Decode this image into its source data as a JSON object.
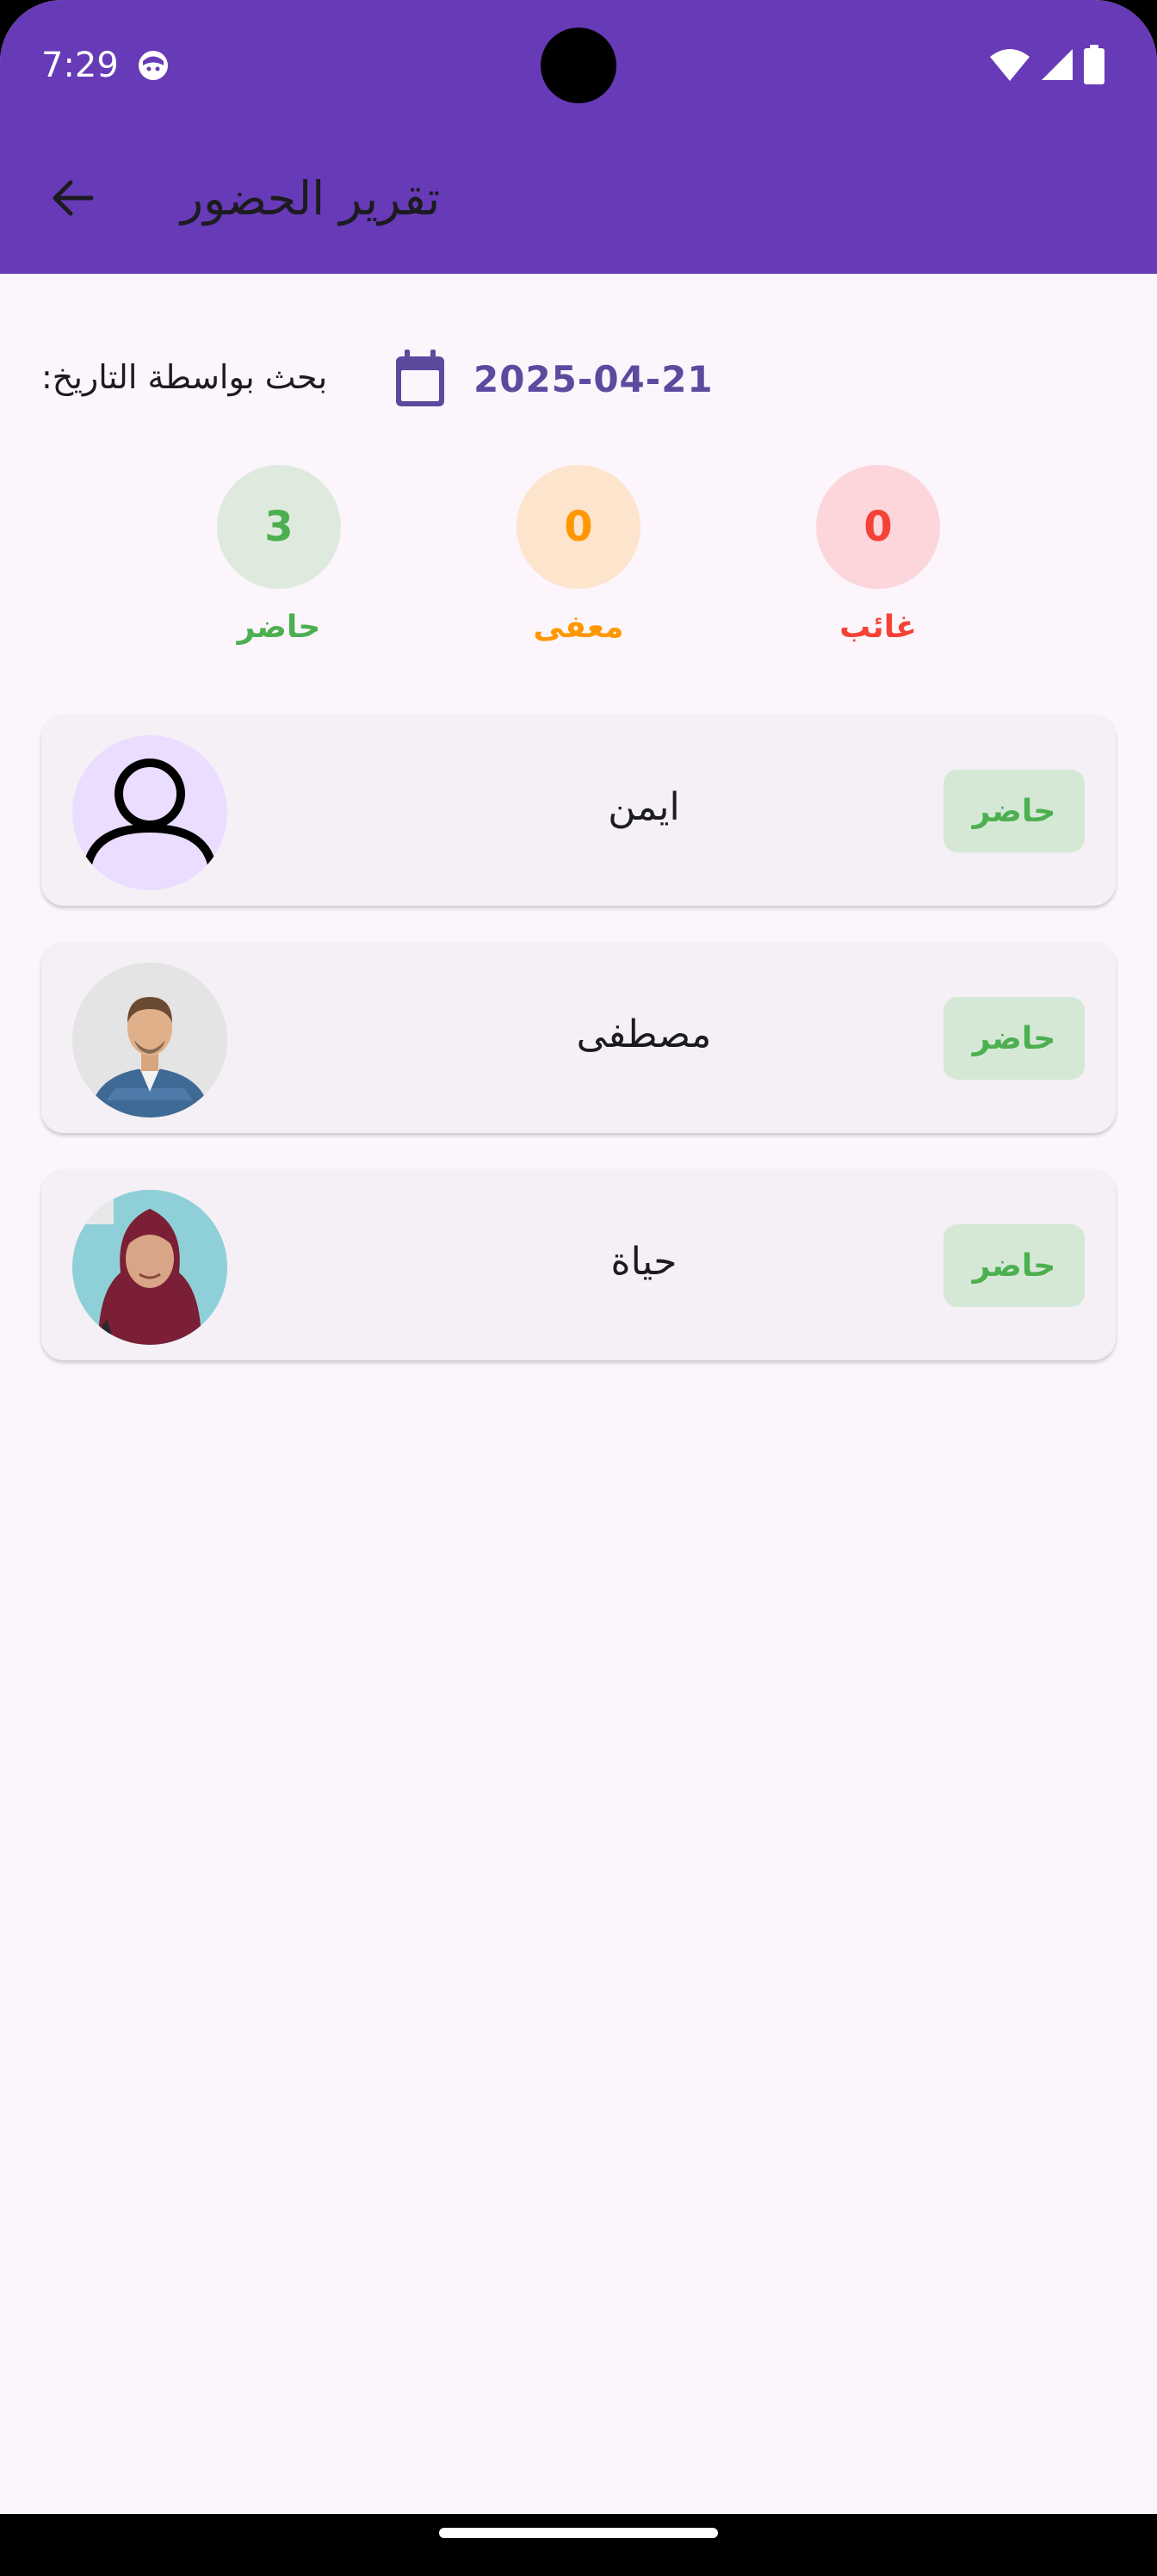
{
  "status_bar": {
    "time": "7:29"
  },
  "app_bar": {
    "title": "تقرير الحضور"
  },
  "search": {
    "label": "بحث بواسطة التاريخ:",
    "date": "2025-04-21"
  },
  "summary": {
    "present": {
      "count": "3",
      "label": "حاضر",
      "color": "#4caf50"
    },
    "excused": {
      "count": "0",
      "label": "معفى",
      "color": "#ff9800"
    },
    "absent": {
      "count": "0",
      "label": "غائب",
      "color": "#f44336"
    }
  },
  "students": [
    {
      "name": "ايمن",
      "status": "حاضر",
      "avatar": "default-person-icon"
    },
    {
      "name": "مصطفى",
      "status": "حاضر",
      "avatar": "man-photo"
    },
    {
      "name": "حياة",
      "status": "حاضر",
      "avatar": "woman-hijab-photo"
    }
  ],
  "colors": {
    "primary": "#673ab7",
    "background": "#fcf5fc",
    "card": "#f4f0f6",
    "date_text": "#5b4a9e"
  }
}
